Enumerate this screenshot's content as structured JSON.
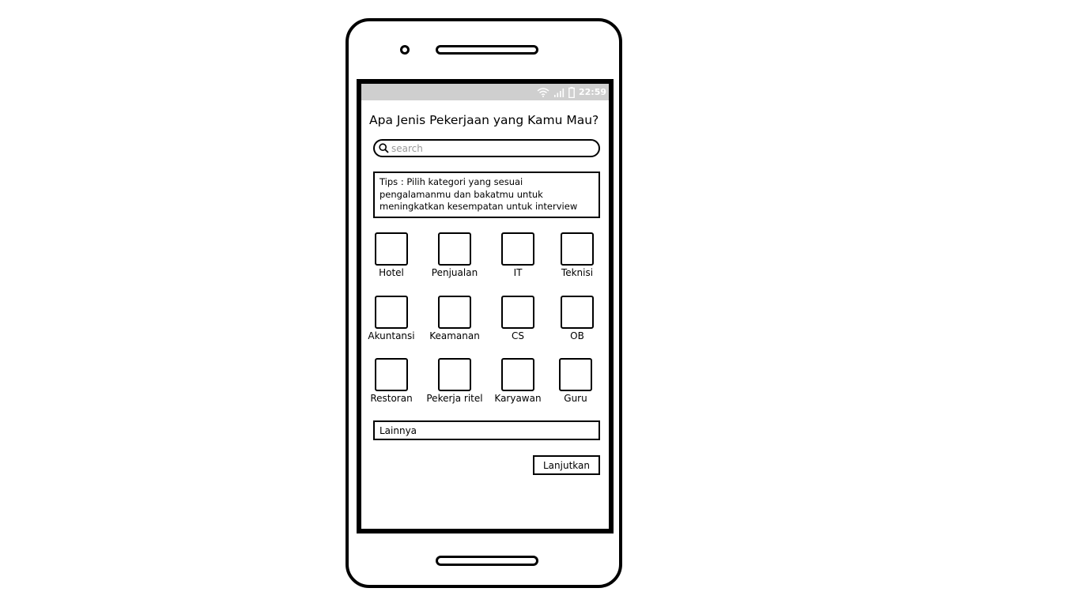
{
  "status_bar": {
    "time": "22:59",
    "icons": [
      "wifi-icon",
      "signal-icon",
      "battery-icon"
    ]
  },
  "page": {
    "title": "Apa Jenis Pekerjaan yang Kamu Mau?"
  },
  "search": {
    "placeholder": "search"
  },
  "tips": {
    "text": "Tips : Pilih kategori yang sesuai pengalamanmu dan bakatmu untuk meningkatkan kesempatan untuk interview"
  },
  "categories": [
    {
      "label": "Hotel"
    },
    {
      "label": "Penjualan"
    },
    {
      "label": "IT"
    },
    {
      "label": "Teknisi"
    },
    {
      "label": "Akuntansi"
    },
    {
      "label": "Keamanan"
    },
    {
      "label": "CS"
    },
    {
      "label": "OB"
    },
    {
      "label": "Restoran"
    },
    {
      "label": "Pekerja ritel"
    },
    {
      "label": "Karyawan"
    },
    {
      "label": "Guru"
    }
  ],
  "other": {
    "label": "Lainnya"
  },
  "actions": {
    "next_label": "Lanjutkan"
  }
}
